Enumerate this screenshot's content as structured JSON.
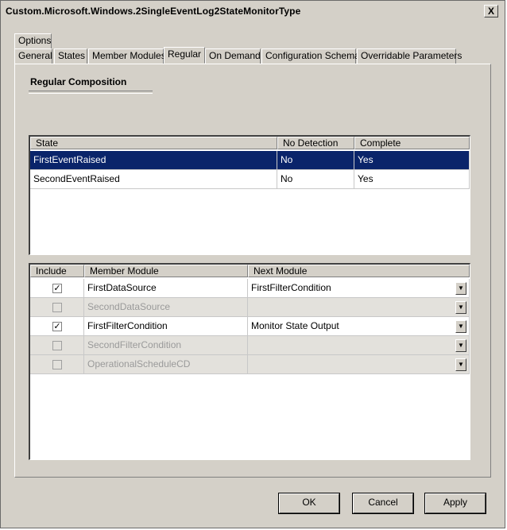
{
  "window": {
    "title": "Custom.Microsoft.Windows.2SingleEventLog2StateMonitorType",
    "close_label": "X"
  },
  "top_tabs": [
    "Options"
  ],
  "tabs": [
    "General",
    "States",
    "Member Modules",
    "Regular",
    "On Demand",
    "Configuration Schema",
    "Overridable Parameters"
  ],
  "selected_tab": "Regular",
  "section": {
    "title": "Regular Composition"
  },
  "state_grid": {
    "headers": {
      "state": "State",
      "no_detection": "No Detection",
      "complete": "Complete"
    },
    "rows": [
      {
        "state": "FirstEventRaised",
        "no_detection": "No",
        "complete": "Yes",
        "selected": true
      },
      {
        "state": "SecondEventRaised",
        "no_detection": "No",
        "complete": "Yes",
        "selected": false
      }
    ]
  },
  "module_grid": {
    "headers": {
      "include": "Include",
      "member_module": "Member Module",
      "next_module": "Next Module"
    },
    "rows": [
      {
        "checked": true,
        "member_module": "FirstDataSource",
        "next_module": "FirstFilterCondition",
        "enabled": true
      },
      {
        "checked": false,
        "member_module": "SecondDataSource",
        "next_module": "",
        "enabled": false
      },
      {
        "checked": true,
        "member_module": "FirstFilterCondition",
        "next_module": "Monitor State Output",
        "enabled": true
      },
      {
        "checked": false,
        "member_module": "SecondFilterCondition",
        "next_module": "",
        "enabled": false
      },
      {
        "checked": false,
        "member_module": "OperationalScheduleCD",
        "next_module": "",
        "enabled": false
      }
    ]
  },
  "buttons": {
    "ok": "OK",
    "cancel": "Cancel",
    "apply": "Apply"
  },
  "colors": {
    "dialog_bg": "#d4d0c8",
    "selection": "#0a246a",
    "disabled_row": "#e3e1dc"
  },
  "icons": {
    "checkbox_checked": "check-mark",
    "dropdown": "chevron-down-icon",
    "close": "close-icon"
  }
}
